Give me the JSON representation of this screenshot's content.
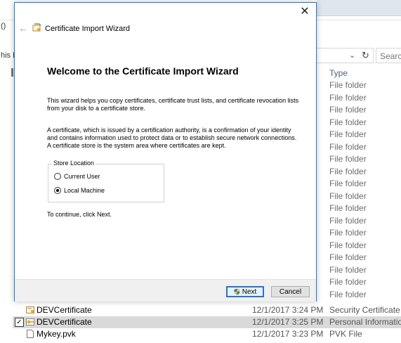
{
  "background": {
    "fragments": {
      "left_top": "()",
      "this": "his F",
      "search_placeholder": "Search"
    },
    "type_column": {
      "header": "Type",
      "cells": [
        "File folder",
        "File folder",
        "File folder",
        "File folder",
        "File folder",
        "File folder",
        "File folder",
        "File folder",
        "File folder",
        "File folder",
        "File folder",
        "File folder",
        "File folder",
        "File folder",
        "File folder",
        "File folder",
        "File folder",
        "File folder"
      ]
    },
    "files": [
      {
        "name": "DEVCertificate",
        "date": "12/1/2017 3:24 PM",
        "type": "Security Certificate",
        "checked": false,
        "selected": false,
        "icon": "certificate-icon"
      },
      {
        "name": "DEVCertificate",
        "date": "12/1/2017 3:25 PM",
        "type": "Personal Information ...",
        "checked": true,
        "selected": true,
        "icon": "pfx-icon"
      },
      {
        "name": "Mykey.pvk",
        "date": "12/1/2017 3:23 PM",
        "type": "PVK File",
        "checked": false,
        "selected": false,
        "icon": "file-icon"
      }
    ]
  },
  "dialog": {
    "title": "Certificate Import Wizard",
    "close_icon": "close-icon",
    "back_icon": "back-arrow-icon",
    "heading": "Welcome to the Certificate Import Wizard",
    "paragraph1": "This wizard helps you copy certificates, certificate trust lists, and certificate revocation lists from your disk to a certificate store.",
    "paragraph2": "A certificate, which is issued by a certification authority, is a confirmation of your identity and contains information used to protect data or to establish secure network connections. A certificate store is the system area where certificates are kept.",
    "store_location": {
      "legend": "Store Location",
      "options": [
        {
          "label": "Current User",
          "selected": false
        },
        {
          "label": "Local Machine",
          "selected": true
        }
      ]
    },
    "continue_text": "To continue, click Next.",
    "buttons": {
      "next": "Next",
      "cancel": "Cancel"
    }
  },
  "colors": {
    "accent": "#1e7bcf",
    "selection": "#d9d9d9",
    "footer": "#f0f0f0"
  }
}
